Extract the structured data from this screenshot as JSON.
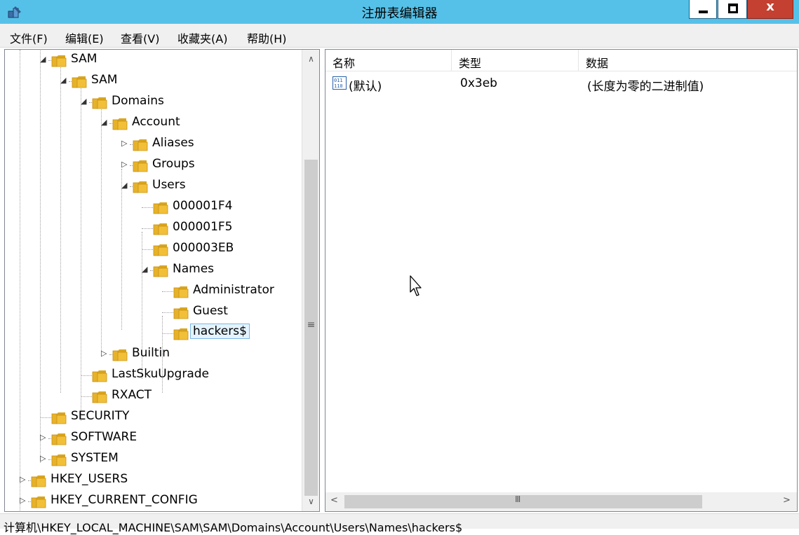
{
  "window": {
    "title": "注册表编辑器",
    "close_glyph": "x"
  },
  "menu": [
    {
      "label": "文件(F)"
    },
    {
      "label": "编辑(E)"
    },
    {
      "label": "查看(V)"
    },
    {
      "label": "收藏夹(A)"
    },
    {
      "label": "帮助(H)"
    }
  ],
  "tree": [
    {
      "label": "SAM",
      "expander": "collapse"
    },
    {
      "label": "SAM",
      "expander": "collapse"
    },
    {
      "label": "Domains",
      "expander": "collapse"
    },
    {
      "label": "Account",
      "expander": "collapse"
    },
    {
      "label": "Aliases",
      "expander": "expand"
    },
    {
      "label": "Groups",
      "expander": "expand"
    },
    {
      "label": "Users",
      "expander": "collapse"
    },
    {
      "label": "000001F4",
      "expander": "none"
    },
    {
      "label": "000001F5",
      "expander": "none"
    },
    {
      "label": "000003EB",
      "expander": "none"
    },
    {
      "label": "Names",
      "expander": "collapse"
    },
    {
      "label": "Administrator",
      "expander": "none"
    },
    {
      "label": "Guest",
      "expander": "none"
    },
    {
      "label": "hackers$",
      "expander": "none",
      "selected": true
    },
    {
      "label": "Builtin",
      "expander": "expand"
    },
    {
      "label": "LastSkuUpgrade",
      "expander": "none"
    },
    {
      "label": "RXACT",
      "expander": "none"
    },
    {
      "label": "SECURITY",
      "expander": "none"
    },
    {
      "label": "SOFTWARE",
      "expander": "expand"
    },
    {
      "label": "SYSTEM",
      "expander": "expand"
    },
    {
      "label": "HKEY_USERS",
      "expander": "expand"
    },
    {
      "label": "HKEY_CURRENT_CONFIG",
      "expander": "expand"
    }
  ],
  "list": {
    "columns": [
      {
        "label": "名称"
      },
      {
        "label": "类型"
      },
      {
        "label": "数据"
      }
    ],
    "rows": [
      {
        "icon": "binary-value-icon",
        "name": "(默认)",
        "type": "0x3eb",
        "data": "(长度为零的二进制值)"
      }
    ]
  },
  "statusbar": {
    "path": "计算机\\HKEY_LOCAL_MACHINE\\SAM\\SAM\\Domains\\Account\\Users\\Names\\hackers$"
  },
  "icons": {
    "folder": "folder-icon",
    "app": "regedit-icon",
    "cursor": "mouse-pointer-icon"
  },
  "colors": {
    "titlebar": "#56c1e8",
    "close_button": "#c44030",
    "folder": "#f2c038",
    "selection": "#e5f3ff"
  }
}
